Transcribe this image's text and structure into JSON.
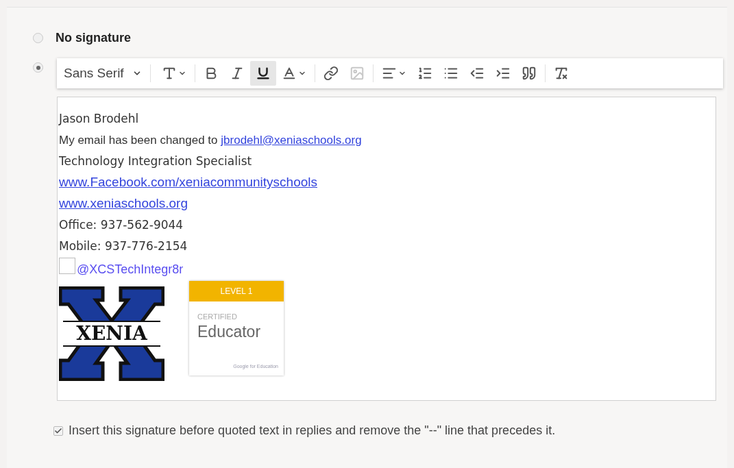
{
  "signature_options": [
    {
      "label": "No signature",
      "selected": false
    },
    {
      "selected": true
    }
  ],
  "font_menu": {
    "label": "Sans Serif"
  },
  "toolbar_buttons": [
    {
      "kind": "size",
      "active": false,
      "disabled": false,
      "dropdown": true
    },
    {
      "kind": "bold",
      "active": false,
      "disabled": false,
      "dropdown": false
    },
    {
      "kind": "italic",
      "active": false,
      "disabled": false,
      "dropdown": false
    },
    {
      "kind": "underline",
      "active": true,
      "disabled": false,
      "dropdown": false
    },
    {
      "kind": "color",
      "active": false,
      "disabled": false,
      "dropdown": true
    },
    {
      "kind": "link",
      "active": false,
      "disabled": false,
      "dropdown": false
    },
    {
      "kind": "image",
      "active": false,
      "disabled": true,
      "dropdown": false
    },
    {
      "kind": "align",
      "active": false,
      "disabled": false,
      "dropdown": true
    },
    {
      "kind": "numbered",
      "active": false,
      "disabled": false,
      "dropdown": false
    },
    {
      "kind": "bulleted",
      "active": false,
      "disabled": false,
      "dropdown": false
    },
    {
      "kind": "outdent",
      "active": false,
      "disabled": false,
      "dropdown": false
    },
    {
      "kind": "indent",
      "active": false,
      "disabled": false,
      "dropdown": false
    },
    {
      "kind": "quote",
      "active": false,
      "disabled": false,
      "dropdown": false
    },
    {
      "kind": "clear",
      "active": false,
      "disabled": false,
      "dropdown": false
    }
  ],
  "signature_lines": [
    {
      "kind": "text",
      "text": "Jason Brodehl"
    },
    {
      "kind": "text_link",
      "text": "My email has been changed to",
      "link": "jbrodehl@xeniaschools.org"
    },
    {
      "kind": "text",
      "text": "Technology Integration Specialist"
    },
    {
      "kind": "link",
      "link": "www.Facebook.com/xeniacommunityschools"
    },
    {
      "kind": "link",
      "link": "www.xeniaschools.org"
    },
    {
      "kind": "text",
      "text": "Office: 937-562-9044"
    },
    {
      "kind": "text",
      "text": "Mobile: 937-776-2154"
    },
    {
      "kind": "image_link",
      "link": "@XCSTechIntegr8r"
    }
  ],
  "logo": {
    "text": "XENIA"
  },
  "badge": {
    "level": "LEVEL 1",
    "certified": "CERTIFIED",
    "title": "Educator",
    "footer": "Google for Education"
  },
  "insert_before_quoted": {
    "label": "Insert this signature before quoted text in replies and remove the \"--\" line that precedes it.",
    "checked": true
  }
}
